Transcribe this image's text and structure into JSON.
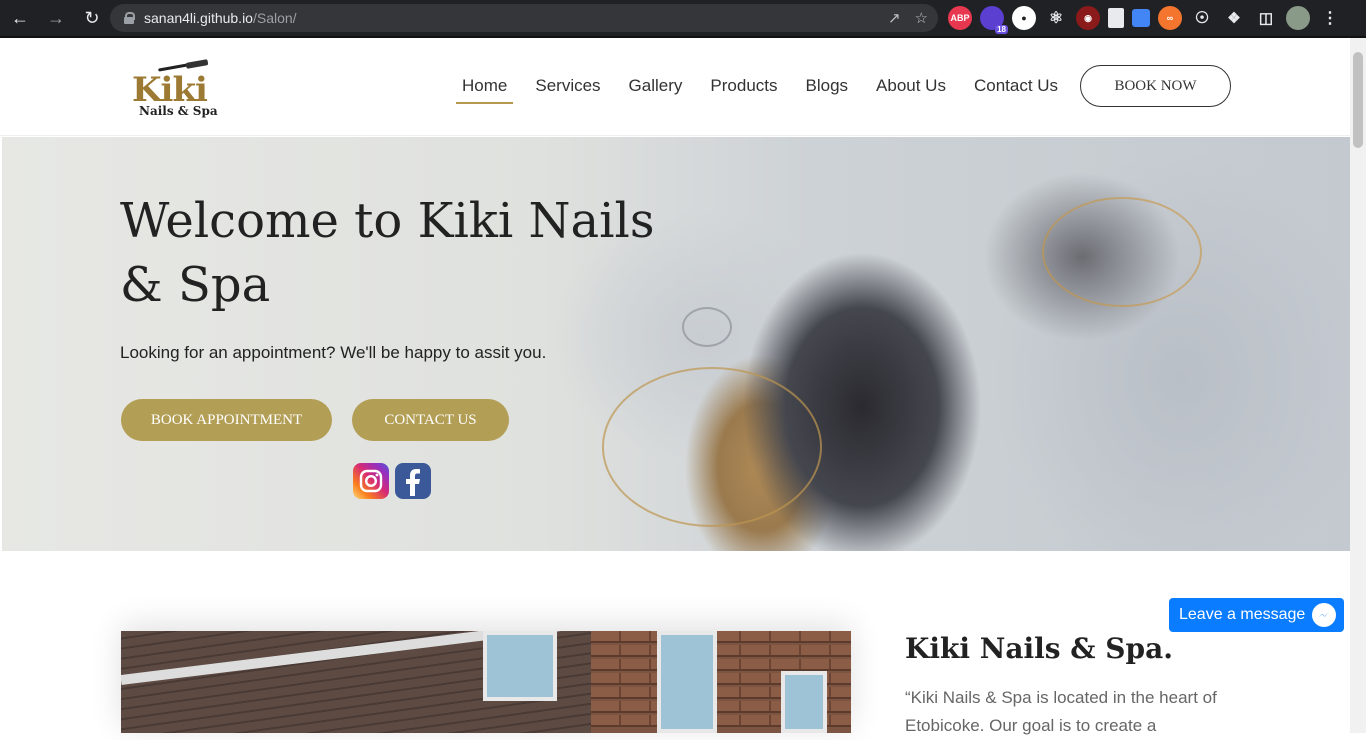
{
  "browser": {
    "url_host": "sanan4li.github.io",
    "url_path": "/Salon/",
    "extension_badge": "18",
    "abp_label": "ABP"
  },
  "site": {
    "logo_main": "Kiki",
    "logo_sub": "Nails & Spa",
    "menu": [
      "Home",
      "Services",
      "Gallery",
      "Products",
      "Blogs",
      "About Us",
      "Contact Us"
    ],
    "active_menu": "Home",
    "book_now": "BOOK NOW",
    "accent_color": "#b39e55"
  },
  "hero": {
    "title": "Welcome to Kiki Nails & Spa",
    "subtitle": "Looking for an appointment? We'll be happy to assit you.",
    "btn_appointment": "BOOK APPOINTMENT",
    "btn_contact": "CONTACT US"
  },
  "about": {
    "title": "Kiki Nails & Spa.",
    "text": "“Kiki Nails & Spa is located in the heart of Etobicoke. Our goal is to create a"
  },
  "messenger": {
    "label": "Leave a message"
  }
}
